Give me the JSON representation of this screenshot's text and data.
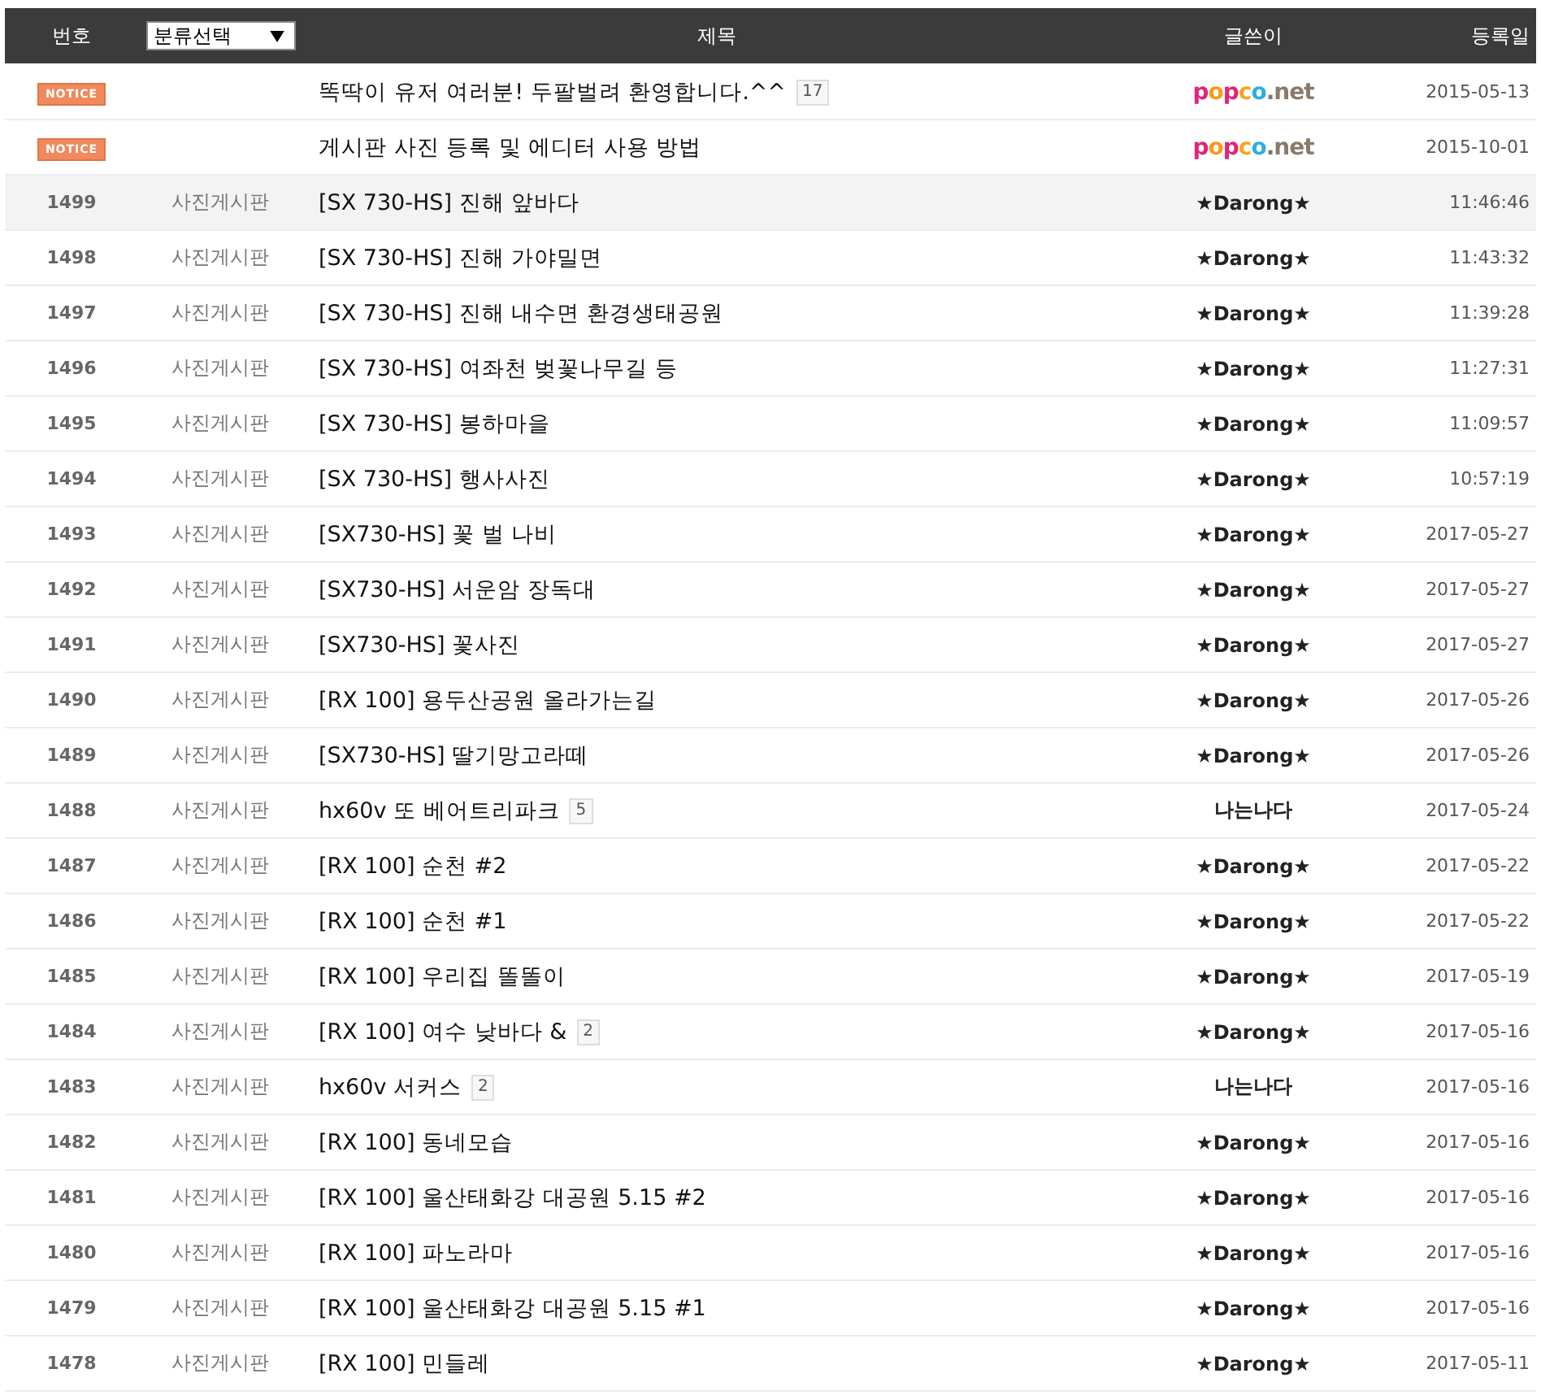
{
  "header": {
    "number": "번호",
    "category_filter": {
      "label": "분류선택"
    },
    "title": "제목",
    "writer": "글쓴이",
    "date": "등록일"
  },
  "rows": [
    {
      "kind": "notice",
      "badge": "NOTICE",
      "title": "똑딱이 유저 여러분! 두팔벌려 환영합니다.^^",
      "comments": "17",
      "writer": {
        "kind": "logo",
        "text": "popco.net"
      },
      "date": "2015-05-13",
      "selected": false
    },
    {
      "kind": "notice",
      "badge": "NOTICE",
      "title": "게시판 사진 등록 및 에디터 사용 방법",
      "writer": {
        "kind": "logo",
        "text": "popco.net"
      },
      "date": "2015-10-01",
      "selected": false
    },
    {
      "kind": "post",
      "number": "1499",
      "category": "사진게시판",
      "title": "[SX 730-HS] 진해 앞바다",
      "writer": {
        "kind": "name",
        "text": "★Darong★"
      },
      "date": "11:46:46",
      "selected": true
    },
    {
      "kind": "post",
      "number": "1498",
      "category": "사진게시판",
      "title": "[SX 730-HS] 진해 가야밀면",
      "writer": {
        "kind": "name",
        "text": "★Darong★"
      },
      "date": "11:43:32",
      "selected": false
    },
    {
      "kind": "post",
      "number": "1497",
      "category": "사진게시판",
      "title": "[SX 730-HS] 진해 내수면 환경생태공원",
      "writer": {
        "kind": "name",
        "text": "★Darong★"
      },
      "date": "11:39:28",
      "selected": false
    },
    {
      "kind": "post",
      "number": "1496",
      "category": "사진게시판",
      "title": "[SX 730-HS] 여좌천 벚꽃나무길 등",
      "writer": {
        "kind": "name",
        "text": "★Darong★"
      },
      "date": "11:27:31",
      "selected": false
    },
    {
      "kind": "post",
      "number": "1495",
      "category": "사진게시판",
      "title": "[SX 730-HS] 봉하마을",
      "writer": {
        "kind": "name",
        "text": "★Darong★"
      },
      "date": "11:09:57",
      "selected": false
    },
    {
      "kind": "post",
      "number": "1494",
      "category": "사진게시판",
      "title": "[SX 730-HS] 행사사진",
      "writer": {
        "kind": "name",
        "text": "★Darong★"
      },
      "date": "10:57:19",
      "selected": false
    },
    {
      "kind": "post",
      "number": "1493",
      "category": "사진게시판",
      "title": "[SX730-HS] 꽃 벌 나비",
      "writer": {
        "kind": "name",
        "text": "★Darong★"
      },
      "date": "2017-05-27",
      "selected": false
    },
    {
      "kind": "post",
      "number": "1492",
      "category": "사진게시판",
      "title": "[SX730-HS] 서운암 장독대",
      "writer": {
        "kind": "name",
        "text": "★Darong★"
      },
      "date": "2017-05-27",
      "selected": false
    },
    {
      "kind": "post",
      "number": "1491",
      "category": "사진게시판",
      "title": "[SX730-HS] 꽃사진",
      "writer": {
        "kind": "name",
        "text": "★Darong★"
      },
      "date": "2017-05-27",
      "selected": false
    },
    {
      "kind": "post",
      "number": "1490",
      "category": "사진게시판",
      "title": "[RX 100] 용두산공원 올라가는길",
      "writer": {
        "kind": "name",
        "text": "★Darong★"
      },
      "date": "2017-05-26",
      "selected": false
    },
    {
      "kind": "post",
      "number": "1489",
      "category": "사진게시판",
      "title": "[SX730-HS] 딸기망고라떼",
      "writer": {
        "kind": "name",
        "text": "★Darong★"
      },
      "date": "2017-05-26",
      "selected": false
    },
    {
      "kind": "post",
      "number": "1488",
      "category": "사진게시판",
      "title": "hx60v 또 베어트리파크",
      "comments": "5",
      "writer": {
        "kind": "name",
        "text": "나는나다"
      },
      "date": "2017-05-24",
      "selected": false
    },
    {
      "kind": "post",
      "number": "1487",
      "category": "사진게시판",
      "title": "[RX 100] 순천 #2",
      "writer": {
        "kind": "name",
        "text": "★Darong★"
      },
      "date": "2017-05-22",
      "selected": false
    },
    {
      "kind": "post",
      "number": "1486",
      "category": "사진게시판",
      "title": "[RX 100] 순천 #1",
      "writer": {
        "kind": "name",
        "text": "★Darong★"
      },
      "date": "2017-05-22",
      "selected": false
    },
    {
      "kind": "post",
      "number": "1485",
      "category": "사진게시판",
      "title": "[RX 100] 우리집 똘똘이",
      "writer": {
        "kind": "name",
        "text": "★Darong★"
      },
      "date": "2017-05-19",
      "selected": false
    },
    {
      "kind": "post",
      "number": "1484",
      "category": "사진게시판",
      "title": "[RX 100] 여수 낮바다 &",
      "comments": "2",
      "writer": {
        "kind": "name",
        "text": "★Darong★"
      },
      "date": "2017-05-16",
      "selected": false
    },
    {
      "kind": "post",
      "number": "1483",
      "category": "사진게시판",
      "title": "hx60v 서커스",
      "comments": "2",
      "writer": {
        "kind": "name",
        "text": "나는나다"
      },
      "date": "2017-05-16",
      "selected": false
    },
    {
      "kind": "post",
      "number": "1482",
      "category": "사진게시판",
      "title": "[RX 100] 동네모습",
      "writer": {
        "kind": "name",
        "text": "★Darong★"
      },
      "date": "2017-05-16",
      "selected": false
    },
    {
      "kind": "post",
      "number": "1481",
      "category": "사진게시판",
      "title": "[RX 100] 울산태화강 대공원 5.15 #2",
      "writer": {
        "kind": "name",
        "text": "★Darong★"
      },
      "date": "2017-05-16",
      "selected": false
    },
    {
      "kind": "post",
      "number": "1480",
      "category": "사진게시판",
      "title": "[RX 100] 파노라마",
      "writer": {
        "kind": "name",
        "text": "★Darong★"
      },
      "date": "2017-05-16",
      "selected": false
    },
    {
      "kind": "post",
      "number": "1479",
      "category": "사진게시판",
      "title": "[RX 100] 울산태화강 대공원 5.15 #1",
      "writer": {
        "kind": "name",
        "text": "★Darong★"
      },
      "date": "2017-05-16",
      "selected": false
    },
    {
      "kind": "post",
      "number": "1478",
      "category": "사진게시판",
      "title": "[RX 100] 민들레",
      "writer": {
        "kind": "name",
        "text": "★Darong★"
      },
      "date": "2017-05-11",
      "selected": false
    }
  ]
}
